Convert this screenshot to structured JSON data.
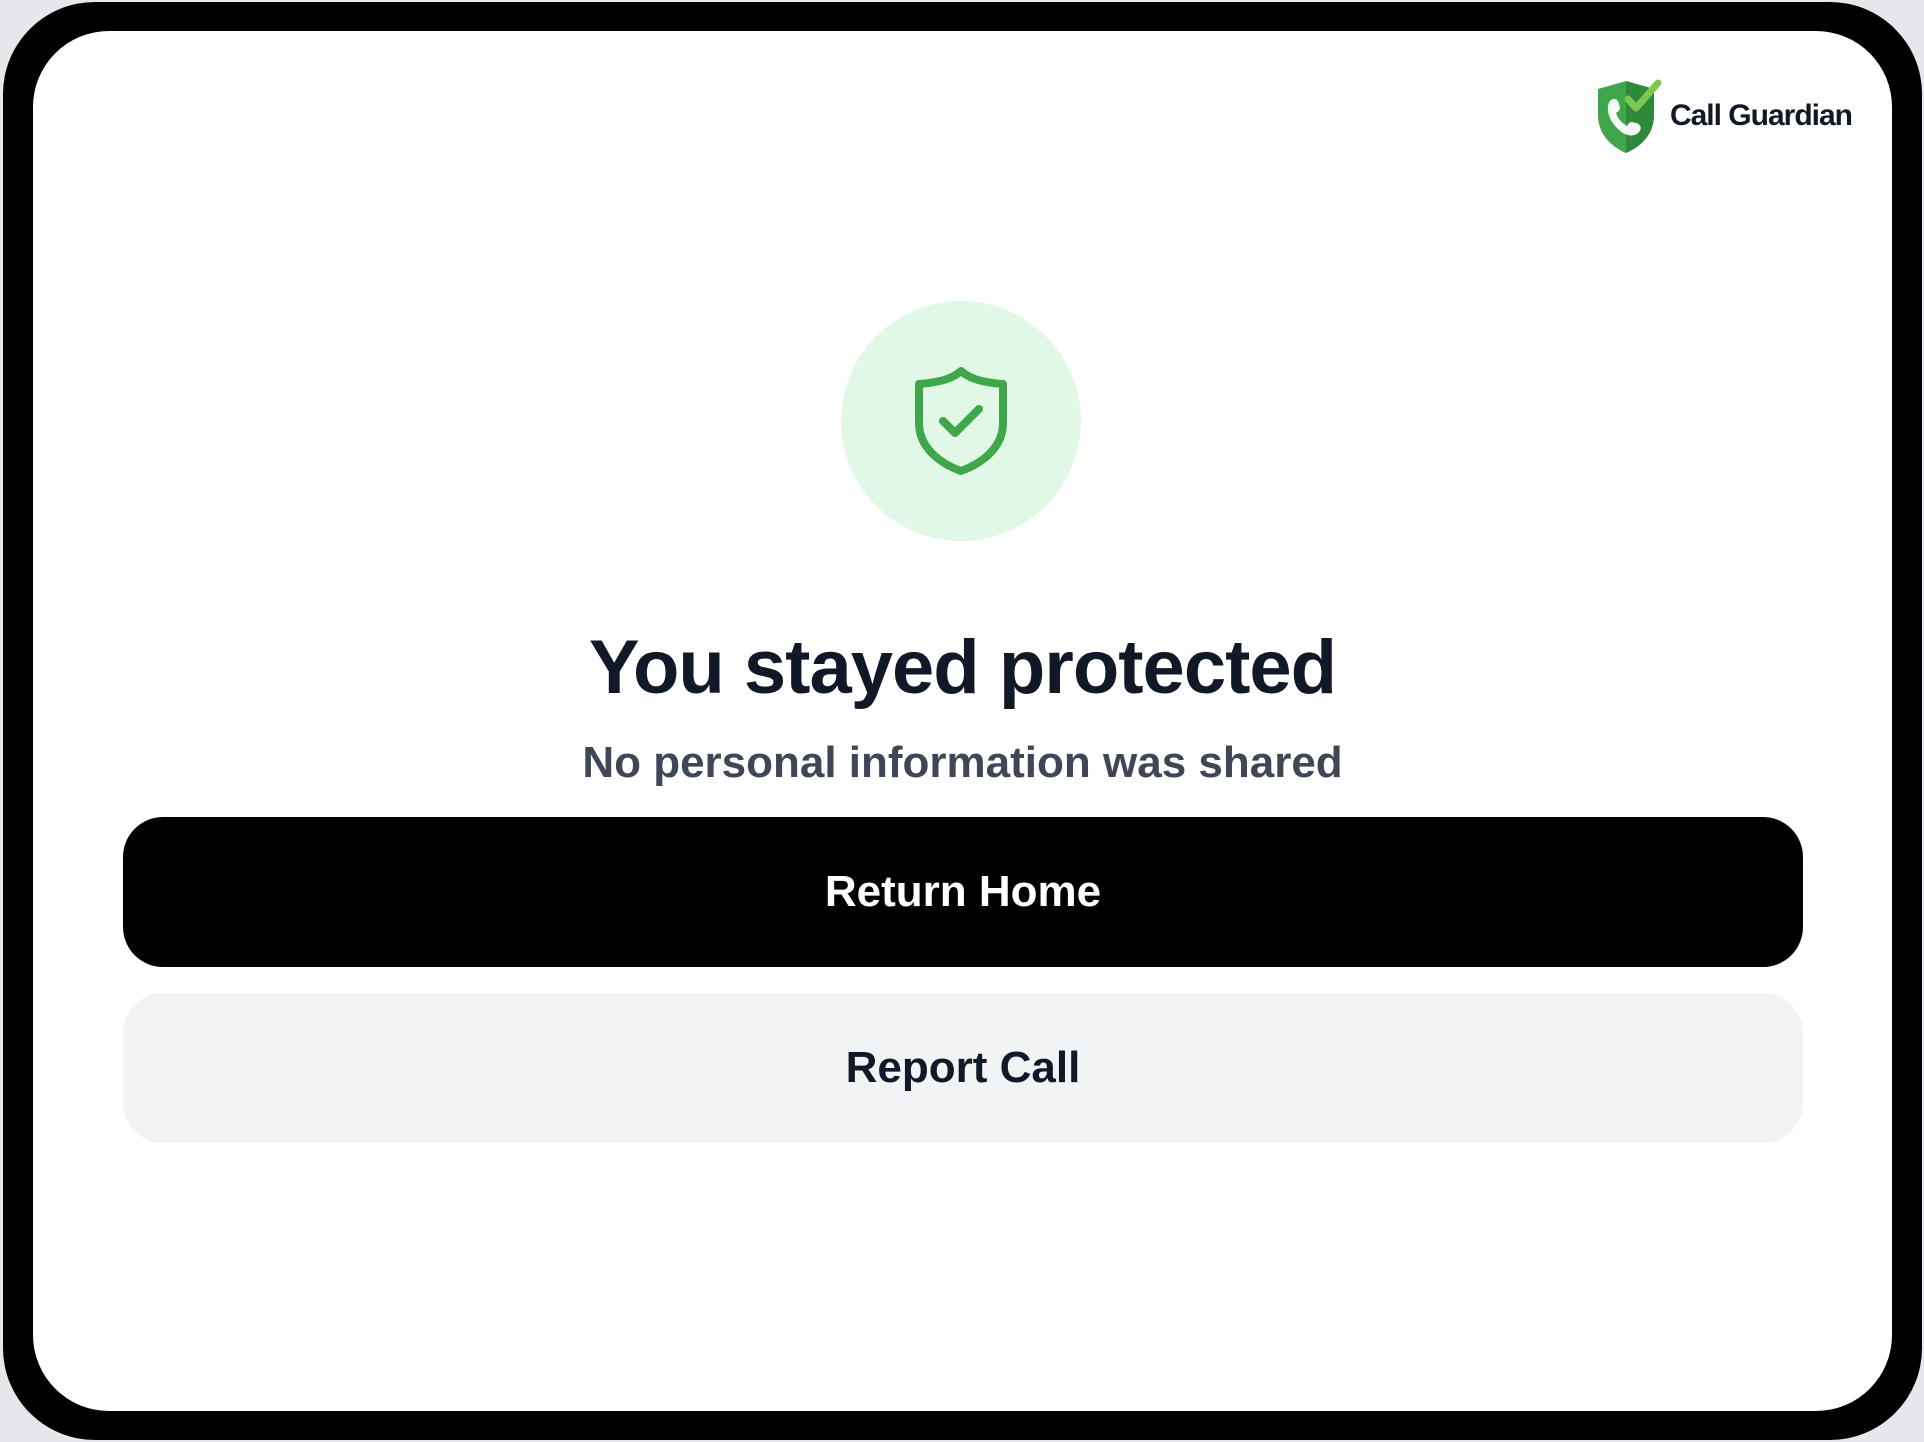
{
  "brand": {
    "name": "Call Guardian",
    "logo_icon": "shield-phone-check-icon",
    "logo_colors": [
      "#3fa64a",
      "#7cc94f",
      "#ffffff"
    ]
  },
  "status": {
    "icon": "shield-check-icon",
    "icon_color": "#3fa64a",
    "circle_color": "#e1f8e7",
    "title": "You stayed protected",
    "subtitle": "No personal information was shared"
  },
  "actions": {
    "primary_label": "Return Home",
    "secondary_label": "Report Call"
  },
  "colors": {
    "primary_button": "#000000",
    "secondary_button": "#f2f3f5",
    "text_dark": "#111827",
    "text_muted": "#3f4656"
  }
}
